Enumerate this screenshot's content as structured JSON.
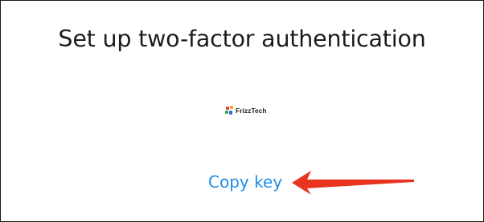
{
  "dialog": {
    "title": "Set up two-factor authentication",
    "copy_key_label": "Copy key"
  },
  "watermark": {
    "text": "FrizzTech",
    "icon": "frizztech-logo-icon"
  },
  "annotation": {
    "icon": "red-arrow-icon",
    "color": "#e8331f"
  },
  "colors": {
    "link": "#1f8de6",
    "title": "#1c1c1e",
    "background": "#ffffff"
  }
}
